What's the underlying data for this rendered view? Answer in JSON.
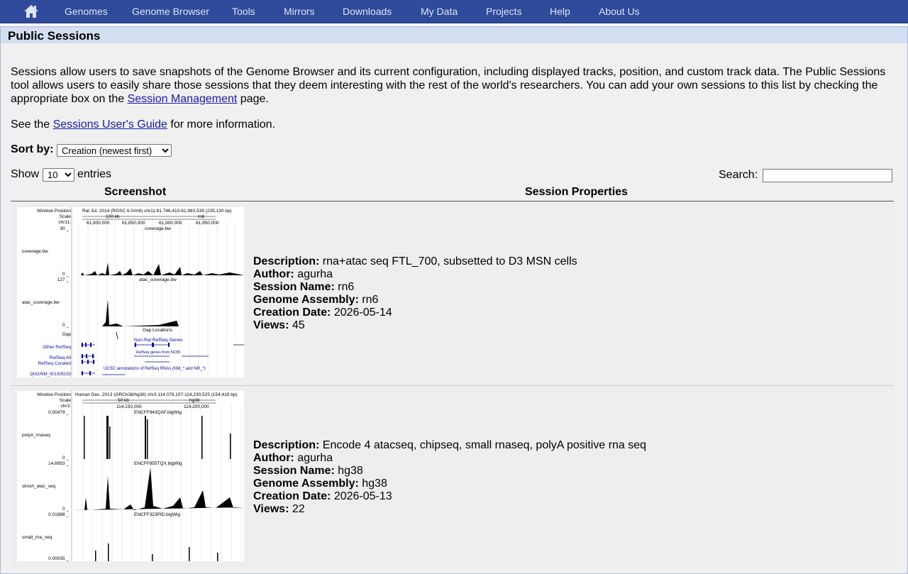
{
  "nav": {
    "home_icon": "home-icon",
    "items": [
      "Genomes",
      "Genome Browser",
      "Tools",
      "Mirrors",
      "Downloads",
      "My Data",
      "Projects",
      "Help",
      "About Us"
    ]
  },
  "page": {
    "title": "Public Sessions",
    "intro": {
      "before_link": "Sessions allow users to save snapshots of the Genome Browser and its current configuration, including displayed tracks, position, and custom track data. The Public Sessions tool allows users to easily share those sessions that they deem interesting with the rest of the world's researchers. You can add your own sessions to this list by checking the appropriate box on the ",
      "link": "Session Management",
      "after_link": " page."
    },
    "guide": {
      "before_link": "See the ",
      "link": "Sessions User's Guide",
      "after_link": " for more information."
    }
  },
  "controls": {
    "sort_label": "Sort by:",
    "sort_value": "Creation (newest first)",
    "show_label": "Show",
    "show_value": "10",
    "entries_label": "entries",
    "search_label": "Search:",
    "search_value": ""
  },
  "table": {
    "headers": [
      "Screenshot",
      "Session Properties"
    ],
    "field_labels": {
      "description": "Description:",
      "author": "Author:",
      "session_name": "Session Name:",
      "assembly": "Genome Assembly:",
      "created": "Creation Date:",
      "views": "Views:"
    },
    "rows": [
      {
        "description": "rna+atac seq FTL_700, subsetted to D3 MSN cells",
        "author": "agurha",
        "session_name": "rn6",
        "assembly": "rn6",
        "created": "2026-05-14",
        "views": "45",
        "shot": {
          "window_position_label": "Window Position",
          "scale_label": "Scale",
          "chrom_label": "chr11:",
          "header": "Rat Jul. 2014 (RGSC 6.0/rn6)   chr11:61,748,410-61,983,539 (235,130 bp)",
          "scale_text": "100 kb",
          "scale_db": "rn6",
          "positions": [
            "61,800,000",
            "61,850,000",
            "61,900,000",
            "61,950,000"
          ],
          "track_labels": [
            "coverage.bw",
            "atac_coverage.bw",
            "Gap",
            "Other RefSeq",
            "RefSeq All",
            "RefSeq Curated",
            "Qtrt2/NM_001305153"
          ],
          "track_titles": [
            "coverage.bw",
            "atac_coverage.bw",
            "Gap Locations",
            "Non-Rat RefSeq Genes",
            "RefSeq genes from NCBI",
            "UCSC annotations of RefSeq RNAs (NM_* and NR_*)"
          ],
          "axis_values": [
            "30 _",
            "0 _",
            "127 _",
            "0 _"
          ]
        }
      },
      {
        "description": "Encode 4 atacseq, chipseq, small rnaseq, polyA positive rna seq",
        "author": "agurha",
        "session_name": "hg38",
        "assembly": "hg38",
        "created": "2026-05-13",
        "views": "22",
        "shot": {
          "window_position_label": "Window Position",
          "scale_label": "Scale",
          "chrom_label": "chr3:",
          "header": "Human Dec. 2013 (GRCh38/hg38)   chr3:114,076,107-114,230,525 (154,419 bp)",
          "scale_text": "50 kb",
          "scale_db": "hg38",
          "positions": [
            "114,150,000",
            "114,200,000"
          ],
          "track_labels": [
            "polyA_rnaseq",
            "sknsh_atac_seq",
            "small_rna_seq"
          ],
          "track_titles": [
            "ENCFF943QAF.bigWig",
            "ENCFF855TQX.bigWig",
            "ENCFF323PID.bigWig"
          ],
          "axis_values": [
            "0.00479 _",
            "0 _",
            "14.8953 _",
            "0 _",
            "0.01888 _",
            "0 _",
            "0.00035 _"
          ]
        }
      }
    ]
  },
  "colors": {
    "nav_bg": "#2f4a9a",
    "header_bg": "#d3dff0",
    "link": "#1a1aa8",
    "refseq_blue": "#0a0a9a"
  }
}
